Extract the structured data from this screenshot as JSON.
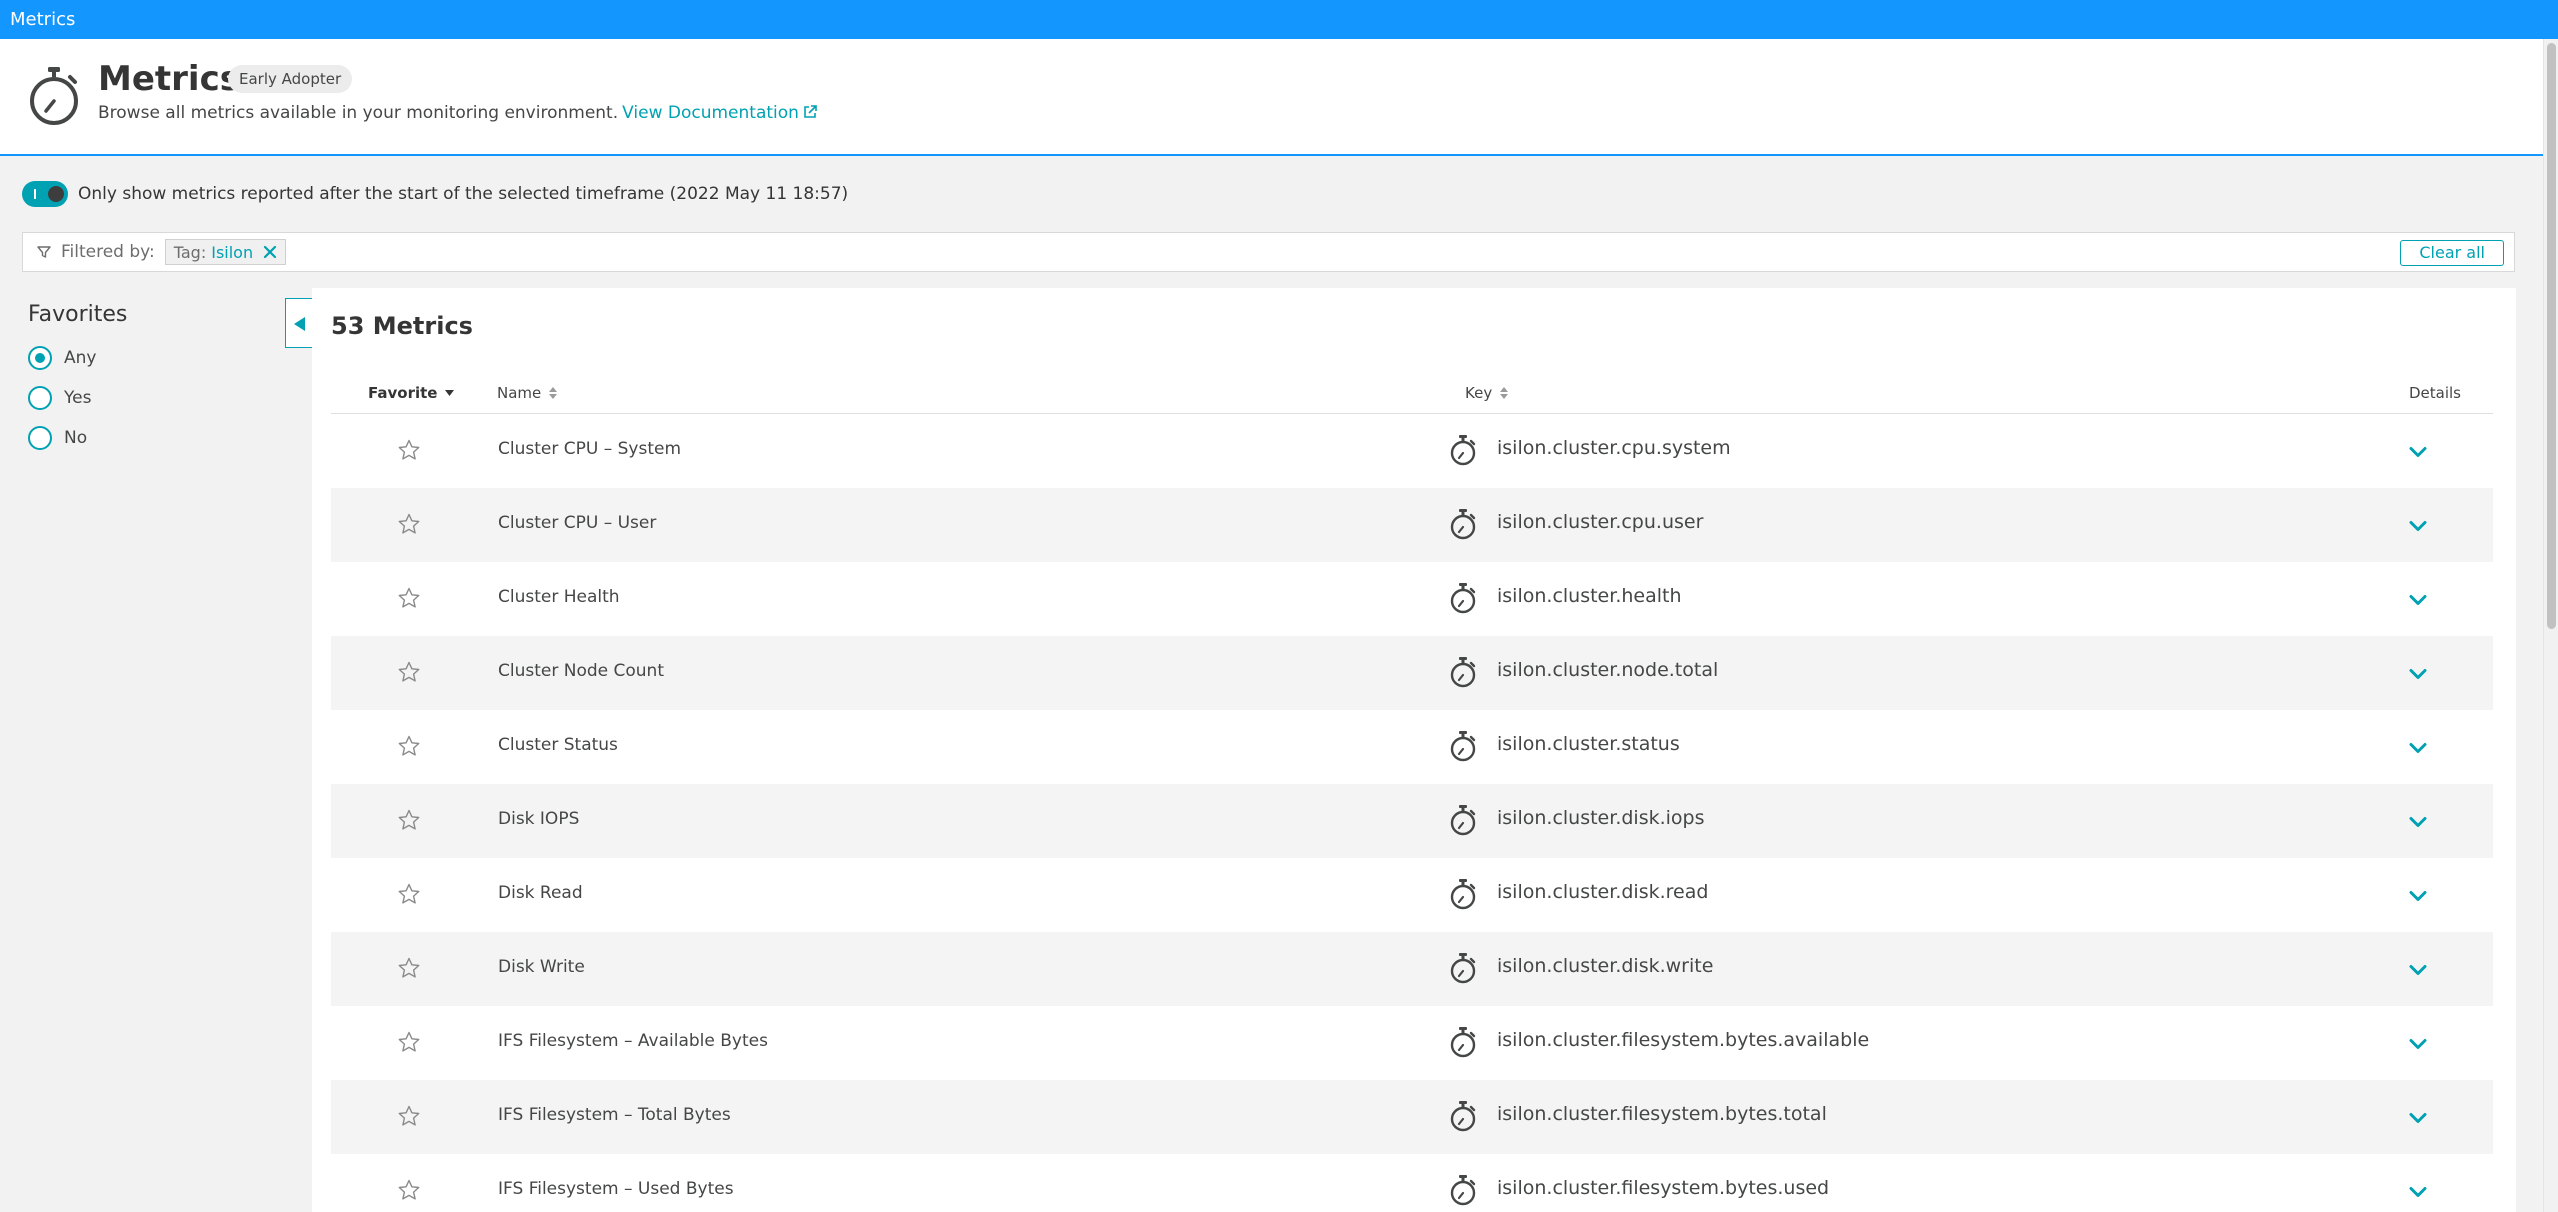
{
  "topbar": {
    "title": "Metrics"
  },
  "header": {
    "title": "Metrics",
    "badge": "Early Adopter",
    "description": "Browse all metrics available in your monitoring environment.",
    "doc_link": "View Documentation"
  },
  "timeframe_toggle": {
    "label": "Only show metrics reported after the start of the selected timeframe (2022 May 11 18:57)",
    "enabled": true
  },
  "filter": {
    "label": "Filtered by:",
    "chip_key": "Tag:",
    "chip_value": "Isilon",
    "clear_label": "Clear all"
  },
  "favorites": {
    "title": "Favorites",
    "options": [
      "Any",
      "Yes",
      "No"
    ],
    "selected": "Any"
  },
  "table": {
    "count_title": "53 Metrics",
    "headers": {
      "favorite": "Favorite",
      "name": "Name",
      "key": "Key",
      "details": "Details"
    },
    "rows": [
      {
        "name": "Cluster CPU – System",
        "key": "isilon.cluster.cpu.system"
      },
      {
        "name": "Cluster CPU – User",
        "key": "isilon.cluster.cpu.user"
      },
      {
        "name": "Cluster Health",
        "key": "isilon.cluster.health"
      },
      {
        "name": "Cluster Node Count",
        "key": "isilon.cluster.node.total"
      },
      {
        "name": "Cluster Status",
        "key": "isilon.cluster.status"
      },
      {
        "name": "Disk IOPS",
        "key": "isilon.cluster.disk.iops"
      },
      {
        "name": "Disk Read",
        "key": "isilon.cluster.disk.read"
      },
      {
        "name": "Disk Write",
        "key": "isilon.cluster.disk.write"
      },
      {
        "name": "IFS Filesystem – Available Bytes",
        "key": "isilon.cluster.filesystem.bytes.available"
      },
      {
        "name": "IFS Filesystem – Total Bytes",
        "key": "isilon.cluster.filesystem.bytes.total"
      },
      {
        "name": "IFS Filesystem – Used Bytes",
        "key": "isilon.cluster.filesystem.bytes.used"
      }
    ]
  },
  "colors": {
    "brand": "#1496ff",
    "accent": "#00a1b2",
    "text": "#454646"
  },
  "icons": {
    "header": "stopwatch-icon",
    "metric": "stopwatch-icon",
    "favorite": "star-outline-icon",
    "details": "chevron-down-icon",
    "filter": "funnel-icon",
    "remove": "close-icon",
    "collapse": "caret-left-icon",
    "external": "external-link-icon"
  }
}
